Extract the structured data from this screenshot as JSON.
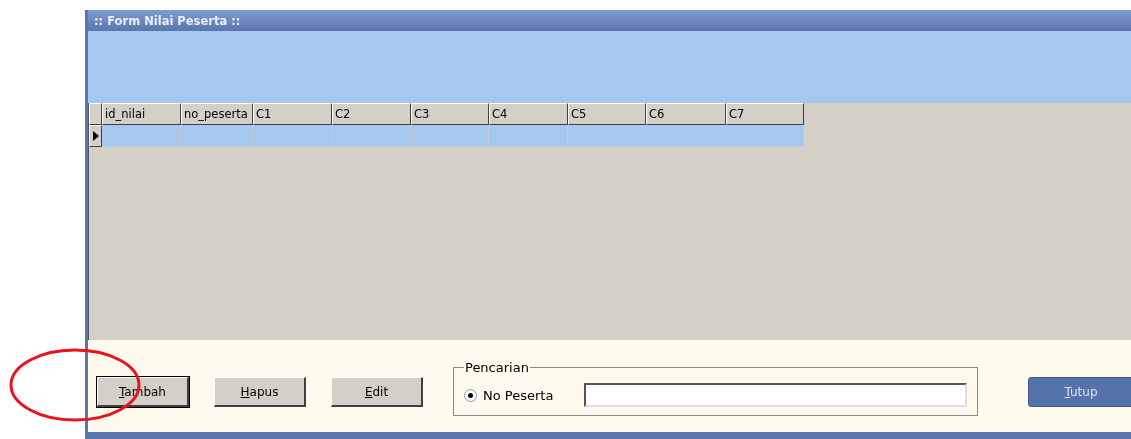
{
  "window": {
    "title": ":: Form Nilai Peserta ::"
  },
  "table": {
    "columns": [
      "id_nilai",
      "no_peserta",
      "C1",
      "C2",
      "C3",
      "C4",
      "C5",
      "C6",
      "C7"
    ],
    "rows": [
      {
        "current": true
      }
    ]
  },
  "buttons": [
    {
      "label": "Tambah",
      "mnemonic": true,
      "focused": true
    },
    {
      "label": "Hapus",
      "mnemonic": true,
      "focused": false
    },
    {
      "label": "Edit",
      "mnemonic": true,
      "focused": false
    }
  ],
  "search": {
    "title": "Pencarian",
    "options": [
      {
        "label": "No Peserta",
        "selected": true
      }
    ]
  },
  "close_button": {
    "label": "Tutup",
    "mnemonic": true
  },
  "annotation": {
    "kind": "ellipse"
  }
}
